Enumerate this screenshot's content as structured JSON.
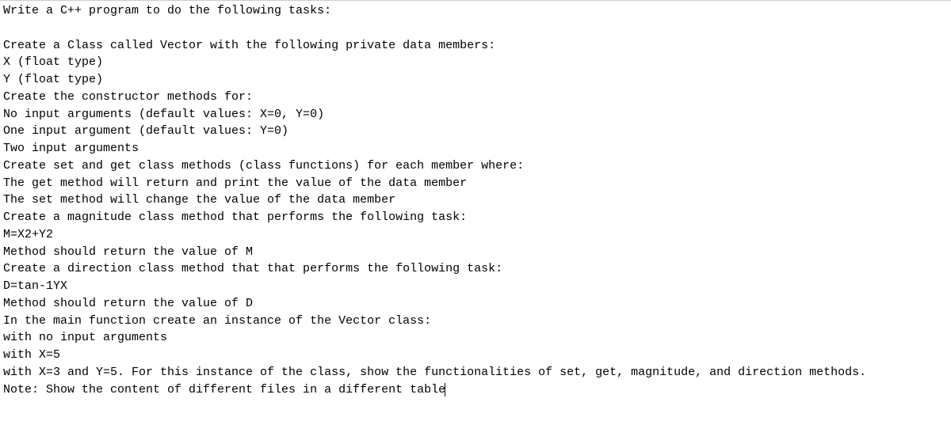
{
  "document": {
    "lines": [
      "Write a C++ program to do the following tasks:",
      "",
      "Create a Class called Vector with the following private data members:",
      "X (float type)",
      "Y (float type)",
      "Create the constructor methods for:",
      "No input arguments (default values: X=0, Y=0)",
      "One input argument (default values: Y=0)",
      "Two input arguments",
      "Create set and get class methods (class functions) for each member where:",
      "The get method will return and print the value of the data member",
      "The set method will change the value of the data member",
      "Create a magnitude class method that performs the following task:",
      "M=X2+Y2",
      "Method should return the value of M",
      "Create a direction class method that that performs the following task:",
      "D=tan-1YX",
      "Method should return the value of D",
      "In the main function create an instance of the Vector class:",
      "with no input arguments",
      "with X=5",
      "with X=3 and Y=5. For this instance of the class, show the functionalities of set, get, magnitude, and direction methods.",
      "Note: Show the content of different files in a different table"
    ],
    "caret_on_last_line": true
  }
}
